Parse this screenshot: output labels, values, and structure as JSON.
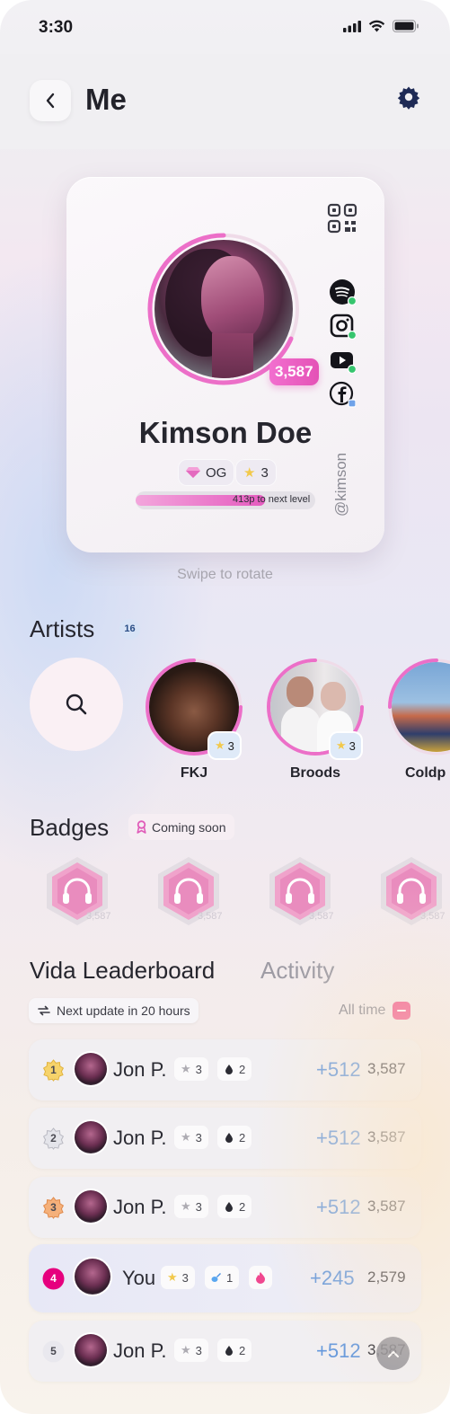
{
  "status_bar": {
    "time": "3:30"
  },
  "header": {
    "title": "Me"
  },
  "profile": {
    "points": "3,587",
    "name": "Kimson Doe",
    "tier_label": "OG",
    "stars": "3",
    "progress_text": "413p to next level",
    "progress_fraction": 0.72,
    "handle": "@kimson",
    "socials": [
      "spotify-icon",
      "instagram-icon",
      "youtube-icon",
      "facebook-icon"
    ]
  },
  "swipe_hint": "Swipe to rotate",
  "artists": {
    "title": "Artists",
    "count": "16",
    "items": [
      {
        "name": "FKJ",
        "stars": "3"
      },
      {
        "name": "Broods",
        "stars": "3"
      },
      {
        "name": "Coldp",
        "stars": ""
      }
    ]
  },
  "badges": {
    "title": "Badges",
    "coming_soon": "Coming soon",
    "items": [
      "3,587",
      "3,587",
      "3,587",
      "3,587"
    ]
  },
  "leaderboard": {
    "tab_active": "Vida Leaderboard",
    "tab_inactive": "Activity",
    "update_note": "Next update in 20 hours",
    "period": "All time",
    "rows": [
      {
        "rank": "1",
        "name": "Jon P.",
        "stars": "3",
        "drops": "2",
        "delta": "+512",
        "total": "3,587"
      },
      {
        "rank": "2",
        "name": "Jon P.",
        "stars": "3",
        "drops": "2",
        "delta": "+512",
        "total": "3,587"
      },
      {
        "rank": "3",
        "name": "Jon P.",
        "stars": "3",
        "drops": "2",
        "delta": "+512",
        "total": "3,587"
      },
      {
        "rank": "4",
        "name": "You",
        "stars": "3",
        "drops": "1",
        "delta": "+245",
        "total": "2,579"
      },
      {
        "rank": "5",
        "name": "Jon P.",
        "stars": "3",
        "drops": "2",
        "delta": "+512",
        "total": "3,587"
      }
    ]
  },
  "colors": {
    "accent_pink": "#e55bbf",
    "delta_blue": "#5e94dc",
    "rank4": "#e6007e"
  }
}
